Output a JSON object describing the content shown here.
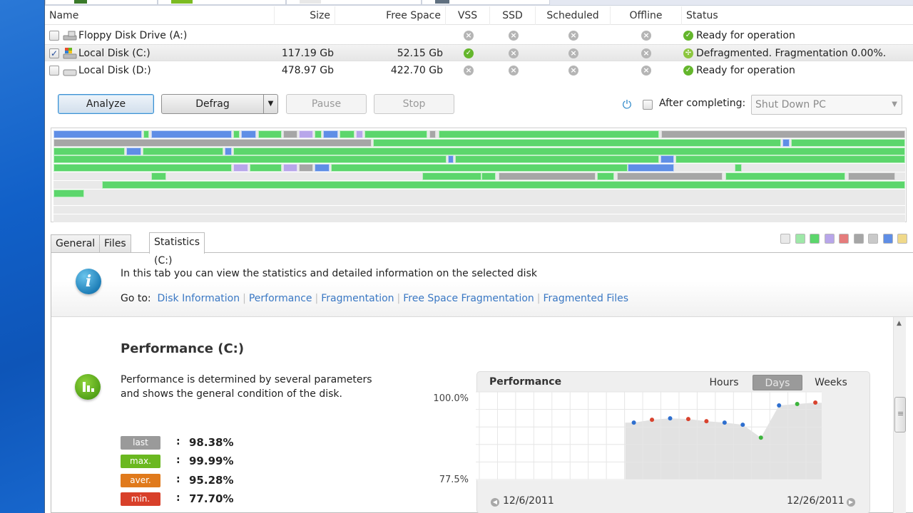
{
  "disk_list": {
    "columns": [
      "Name",
      "Size",
      "Free Space",
      "VSS",
      "SSD",
      "Scheduled",
      "Offline",
      "Status"
    ],
    "rows": [
      {
        "name": "Floppy Disk Drive (A:)",
        "checked": false,
        "size": "",
        "free": "",
        "vss": "no",
        "ssd": "no",
        "scheduled": "no",
        "offline": "no",
        "status": "Ready for operation",
        "status_icon": "check-icon"
      },
      {
        "name": "Local Disk (C:)",
        "checked": true,
        "size": "117.19 Gb",
        "free": "52.15 Gb",
        "vss": "yes",
        "ssd": "no",
        "scheduled": "no",
        "offline": "no",
        "status": "Defragmented. Fragmentation 0.00%.",
        "status_icon": "defrag-icon",
        "selected": true
      },
      {
        "name": "Local Disk (D:)",
        "checked": false,
        "size": "478.97 Gb",
        "free": "422.70 Gb",
        "vss": "no",
        "ssd": "no",
        "scheduled": "no",
        "offline": "no",
        "status": "Ready for operation",
        "status_icon": "check-icon"
      }
    ]
  },
  "toolbar": {
    "analyze_label": "Analyze",
    "defrag_label": "Defrag",
    "pause_label": "Pause",
    "stop_label": "Stop",
    "after_completing_label": "After completing:",
    "after_completing_checked": false,
    "after_completing_value": "Shut Down PC"
  },
  "cluster_map": {
    "legend_colors": [
      "#e9e9e9",
      "#9ee8a8",
      "#5cd66c",
      "#b8a6ea",
      "#e57c7c",
      "#a6a6a6",
      "#c9c9c9",
      "#5f8ee6",
      "#f0d98a"
    ]
  },
  "tabs": {
    "items": [
      {
        "label": "General",
        "active": false
      },
      {
        "label": "Files (C:)",
        "active": false
      },
      {
        "label": "Statistics (C:)",
        "active": true
      }
    ]
  },
  "statistics": {
    "intro": "In this tab you can view the statistics and detailed information on the selected disk",
    "goto_label": "Go to:",
    "goto_links": [
      "Disk Information",
      "Performance",
      "Fragmentation",
      "Free Space Fragmentation",
      "Fragmented Files"
    ],
    "performance": {
      "title": "Performance (C:)",
      "description": "Performance is determined by several parameters and shows the general condition of the disk.",
      "stats": [
        {
          "tag": "last",
          "value": "98.38%",
          "color": "#9a9a9a"
        },
        {
          "tag": "max.",
          "value": "99.99%",
          "color": "#6ab820"
        },
        {
          "tag": "aver.",
          "value": "95.28%",
          "color": "#e07a1c"
        },
        {
          "tag": "min.",
          "value": "77.70%",
          "color": "#d8402a"
        }
      ]
    }
  },
  "chart_data": {
    "type": "area",
    "title": "Performance",
    "range_options": [
      "Hours",
      "Days",
      "Weeks"
    ],
    "range_selected": "Days",
    "ylim": [
      77.5,
      100.0
    ],
    "ytick_labels": [
      "100.0%",
      "77.5%"
    ],
    "x_start_label": "12/6/2011",
    "x_end_label": "12/26/2011",
    "grid": true,
    "points": [
      {
        "value": 93.4,
        "color": "#2e6fcf"
      },
      {
        "value": 94.2,
        "color": "#d8432e"
      },
      {
        "value": 94.6,
        "color": "#2e6fcf"
      },
      {
        "value": 94.4,
        "color": "#d8432e"
      },
      {
        "value": 93.8,
        "color": "#d8432e"
      },
      {
        "value": 93.4,
        "color": "#2e6fcf"
      },
      {
        "value": 92.8,
        "color": "#2e6fcf"
      },
      {
        "value": 89.2,
        "color": "#3cb43c"
      },
      {
        "value": 98.2,
        "color": "#2e6fcf"
      },
      {
        "value": 98.6,
        "color": "#3cb43c"
      },
      {
        "value": 99.0,
        "color": "#d8432e"
      },
      {
        "value": 98.8,
        "color": "#d8432e"
      },
      {
        "value": 98.4,
        "color": "#3cb43c"
      }
    ],
    "empty_leading_slots": 8
  }
}
